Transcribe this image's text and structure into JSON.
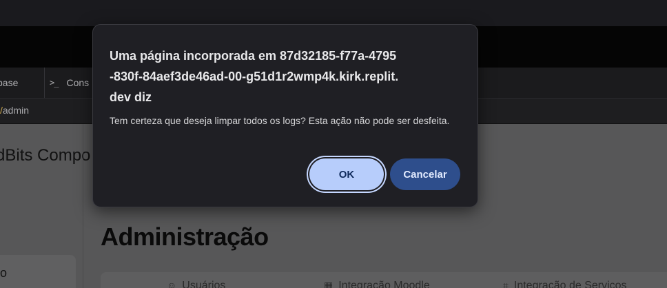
{
  "tabs": {
    "database_label_partial": "base",
    "console_icon": ">_",
    "console_label_partial": "Cons"
  },
  "address_bar": {
    "url_slash": "/",
    "url_partial": "admin"
  },
  "page": {
    "brand_partial": "dBits Compo",
    "nav_active_label_partial": "o",
    "title": "Administração",
    "tab_strip": [
      {
        "icon": "users-icon",
        "label": "Usuários"
      },
      {
        "icon": "calendar-icon",
        "label": "Integração Moodle"
      },
      {
        "icon": "plug-icon",
        "label": "Integração de Serviços"
      }
    ]
  },
  "dialog": {
    "title": "Uma página incorporada em 87d32185-f77a-4795-830f-84aef3de46ad-00-g51d1r2wmp4k.kirk.replit.dev diz",
    "message": "Tem certeza que deseja limpar todos os logs? Esta ação não pode ser desfeita.",
    "ok_label": "OK",
    "cancel_label": "Cancelar"
  },
  "colors": {
    "dialog_bg": "#1f1f24",
    "ok_bg": "#b7cdfb",
    "cancel_bg": "#2e4e8c"
  }
}
